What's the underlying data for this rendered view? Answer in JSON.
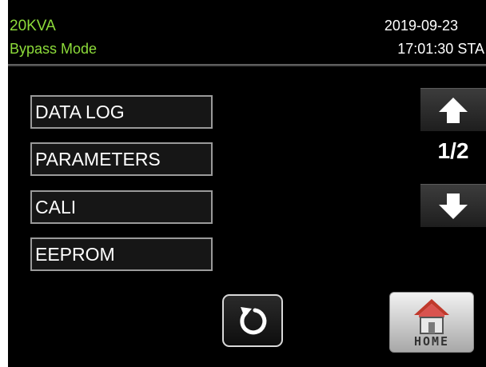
{
  "header": {
    "model": "20KVA",
    "mode": "Bypass Mode",
    "date": "2019-09-23",
    "time": "17:01:30 STA"
  },
  "menu": {
    "items": [
      {
        "label": "DATA LOG"
      },
      {
        "label": "PARAMETERS"
      },
      {
        "label": "CALI"
      },
      {
        "label": "EEPROM"
      }
    ]
  },
  "pagination": {
    "indicator": "1/2",
    "up_icon": "arrow-up-icon",
    "down_icon": "arrow-down-icon"
  },
  "footer": {
    "back_icon": "refresh-icon",
    "home_label": "HOME",
    "home_icon": "house-icon"
  },
  "colors": {
    "status_text": "#8ddc3a",
    "background": "#000000",
    "text": "#ffffff",
    "roof": "#c0392b"
  }
}
